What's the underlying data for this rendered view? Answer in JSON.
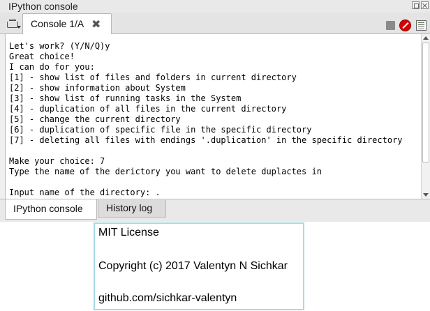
{
  "pane": {
    "title": "IPython console"
  },
  "tabbar": {
    "console_tab_label": "Console 1/A",
    "close_tab_glyph": "✖"
  },
  "toolbar_icons": [
    "options-menu-icon",
    "stop-icon",
    "interrupt-kernel-icon",
    "console-options-icon"
  ],
  "console": {
    "lines": [
      "Let's work? (Y/N/Q)y",
      "Great choice!",
      "I can do for you:",
      "[1] - show list of files and folders in current directory",
      "[2] - show information about System",
      "[3] - show list of running tasks in the System",
      "[4] - duplication of all files in the current directory",
      "[5] - change the current directory",
      "[6] - duplication of specific file in the specific directory",
      "[7] - deleting all files with endings '.duplication' in the specific directory",
      "",
      "Make your choice: 7",
      "Type the name of the derictory you want to delete duplactes in",
      "",
      "Input name of the directory: ."
    ]
  },
  "bottom_tabs": {
    "ipython_console": "IPython console",
    "history_log": "History log"
  },
  "license": {
    "line1": "MIT License",
    "line2": "Copyright (c) 2017 Valentyn N Sichkar",
    "line3": "github.com/sichkar-valentyn"
  },
  "colors": {
    "interrupt_red": "#d60000",
    "license_border": "#a6dce4"
  }
}
